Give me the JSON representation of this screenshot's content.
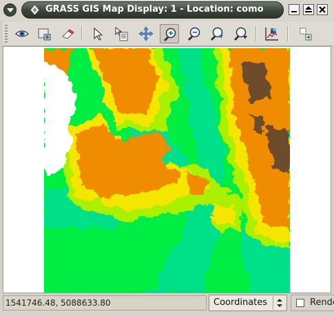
{
  "window": {
    "title": "GRASS GIS Map Display: 1 - Location: como"
  },
  "toolbar": {
    "tools": [
      {
        "name": "display-map",
        "icon": "eye-icon"
      },
      {
        "name": "render-map",
        "icon": "render-icon"
      },
      {
        "name": "erase-display",
        "icon": "eraser-icon"
      },
      {
        "name": "pointer",
        "icon": "arrow-pointer-icon"
      },
      {
        "name": "query",
        "icon": "query-icon"
      },
      {
        "name": "pan",
        "icon": "pan-icon"
      },
      {
        "name": "zoom-in",
        "icon": "zoom-in-icon",
        "active": true
      },
      {
        "name": "zoom-out",
        "icon": "zoom-out-icon"
      },
      {
        "name": "zoom-back",
        "icon": "zoom-back-icon"
      },
      {
        "name": "zoom-menu",
        "icon": "zoom-menu-icon"
      },
      {
        "name": "analyze",
        "icon": "analyze-icon"
      },
      {
        "name": "overlay",
        "icon": "overlay-icon"
      }
    ]
  },
  "map": {
    "colors": {
      "background": "#ffffff",
      "lowland": "#00ee44",
      "valley": "#00e088",
      "midland": "#aaf000",
      "hills": "#f5e600",
      "highland": "#f08c00",
      "peaks": "#6e4b2a"
    }
  },
  "statusbar": {
    "coordinates": "1541746.48, 5088633.80",
    "mode_selected": "Coordinates",
    "render_label": "Render",
    "render_checked": false
  }
}
